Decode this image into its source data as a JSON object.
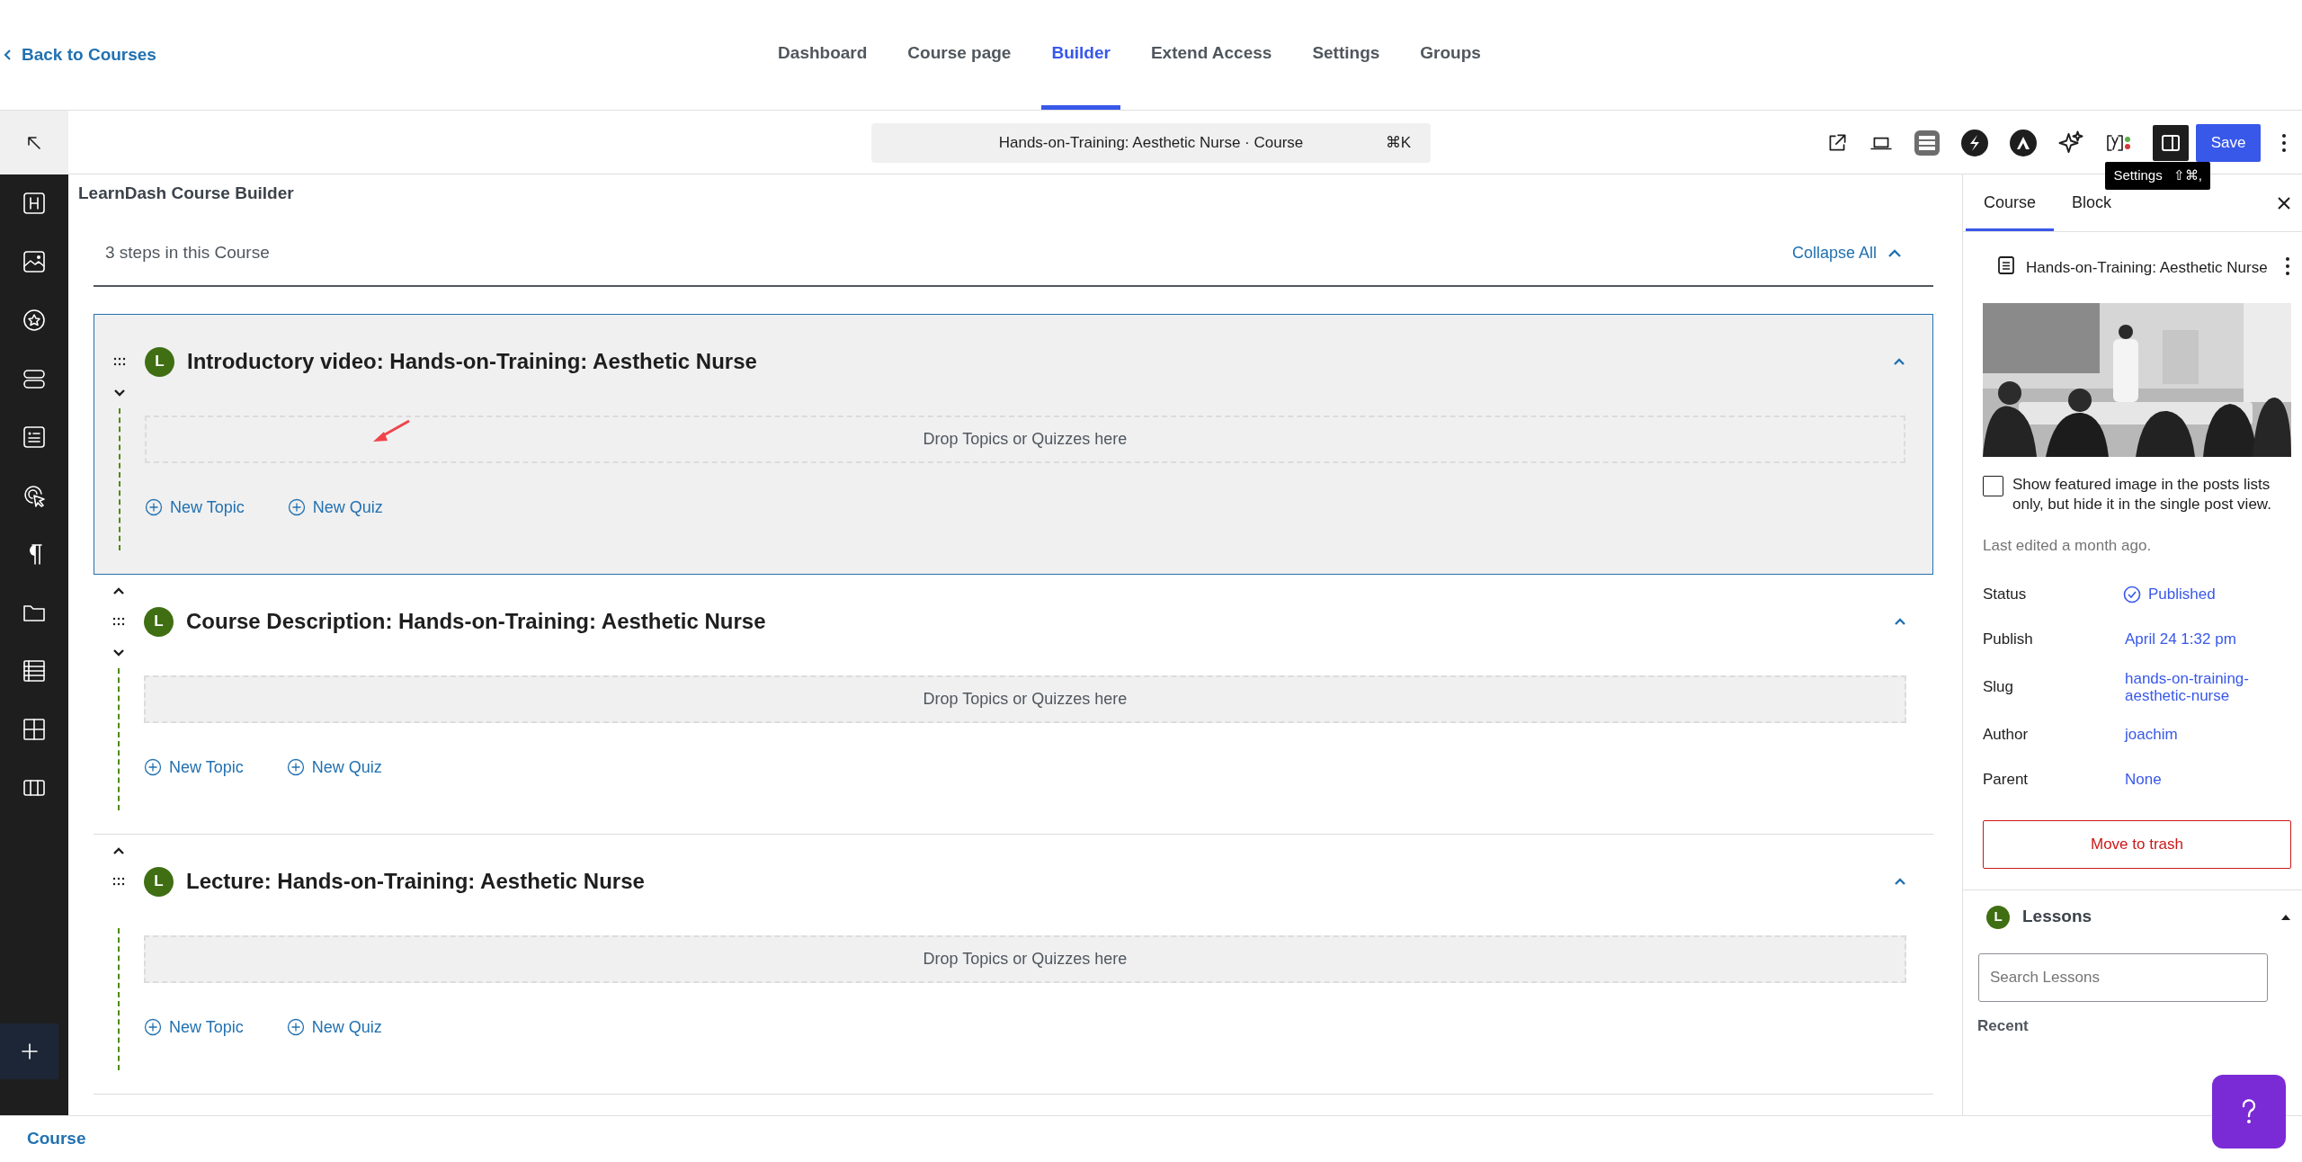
{
  "back_link": "Back to Courses",
  "tabs": [
    {
      "label": "Dashboard",
      "selected": false
    },
    {
      "label": "Course page",
      "selected": false
    },
    {
      "label": "Builder",
      "selected": true
    },
    {
      "label": "Extend Access",
      "selected": false
    },
    {
      "label": "Settings",
      "selected": false
    },
    {
      "label": "Groups",
      "selected": false
    }
  ],
  "command_bar": {
    "title": "Hands-on-Training: Aesthetic Nurse · Course",
    "shortcut": "⌘K"
  },
  "toolbar": {
    "settings_open": true,
    "save": "Save"
  },
  "tooltip": {
    "label": "Settings",
    "shortcut": "⇧⌘,"
  },
  "builder": {
    "heading": "LearnDash Course Builder",
    "steps": "3 steps in this Course",
    "collapse_all": "Collapse All",
    "lessons": [
      {
        "badge": "L",
        "title": "Introductory video: Hands-on-Training: Aesthetic Nurse",
        "selected": true,
        "expanded": true,
        "can_move_up": false,
        "can_move_down": true,
        "drop_zone": "Drop Topics or Quizzes here",
        "new_topic": "New Topic",
        "new_quiz": "New Quiz"
      },
      {
        "badge": "L",
        "title": "Course Description: Hands-on-Training: Aesthetic Nurse",
        "selected": false,
        "expanded": true,
        "can_move_up": true,
        "can_move_down": true,
        "drop_zone": "Drop Topics or Quizzes here",
        "new_topic": "New Topic",
        "new_quiz": "New Quiz"
      },
      {
        "badge": "L",
        "title": "Lecture: Hands-on-Training: Aesthetic Nurse",
        "selected": false,
        "expanded": true,
        "can_move_up": true,
        "can_move_down": false,
        "drop_zone": "Drop Topics or Quizzes here",
        "new_topic": "New Topic",
        "new_quiz": "New Quiz"
      }
    ]
  },
  "sidebar": {
    "tabs": [
      {
        "label": "Course",
        "selected": true
      },
      {
        "label": "Block",
        "selected": false
      }
    ],
    "post_title": "Hands-on-Training: Aesthetic Nurse",
    "checkbox": {
      "label": "Show featured image in the posts lists only, but hide it in the single post view.",
      "checked": false
    },
    "last_edited": "Last edited a month ago.",
    "fields": [
      {
        "label": "Status",
        "value": "Published",
        "kind": "status"
      },
      {
        "label": "Publish",
        "value": "April 24 1:32 pm",
        "kind": "text"
      },
      {
        "label": "Slug",
        "value": "hands-on-training-aesthetic-nurse",
        "kind": "text"
      },
      {
        "label": "Author",
        "value": "joachim",
        "kind": "text"
      },
      {
        "label": "Parent",
        "value": "None",
        "kind": "text"
      }
    ],
    "trash": "Move to trash",
    "lessons_panel": {
      "badge": "L",
      "title": "Lessons",
      "expanded": true,
      "search_placeholder": "Search Lessons",
      "recent": "Recent"
    }
  },
  "footer": {
    "breadcrumb": "Course"
  }
}
